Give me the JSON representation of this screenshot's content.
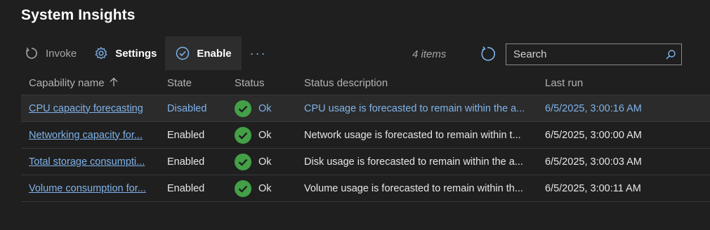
{
  "title": "System Insights",
  "toolbar": {
    "invoke_label": "Invoke",
    "settings_label": "Settings",
    "enable_label": "Enable",
    "more_label": "···"
  },
  "count_text": "4 items",
  "search": {
    "placeholder": "Search",
    "value": ""
  },
  "colors": {
    "link": "#7fb3ea",
    "ok_green": "#43a047",
    "background": "#1f1f1f"
  },
  "columns": {
    "name": "Capability name",
    "state": "State",
    "status": "Status",
    "description": "Status description",
    "last_run": "Last run"
  },
  "rows": [
    {
      "name": "CPU capacity forecasting",
      "state": "Disabled",
      "status": "Ok",
      "description": "CPU usage is forecasted to remain within the a...",
      "last_run": "6/5/2025, 3:00:16 AM"
    },
    {
      "name": "Networking capacity for...",
      "state": "Enabled",
      "status": "Ok",
      "description": "Network usage is forecasted to remain within t...",
      "last_run": "6/5/2025, 3:00:00 AM"
    },
    {
      "name": "Total storage consumpti...",
      "state": "Enabled",
      "status": "Ok",
      "description": "Disk usage is forecasted to remain within the a...",
      "last_run": "6/5/2025, 3:00:03 AM"
    },
    {
      "name": "Volume consumption for...",
      "state": "Enabled",
      "status": "Ok",
      "description": "Volume usage is forecasted to remain within th...",
      "last_run": "6/5/2025, 3:00:11 AM"
    }
  ]
}
